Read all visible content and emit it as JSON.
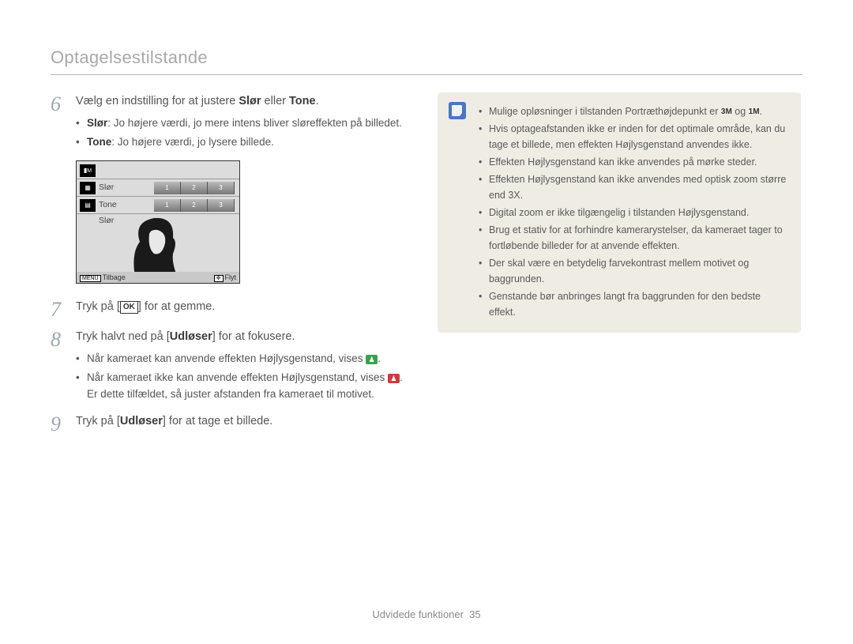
{
  "header": "Optagelsestilstande",
  "steps": {
    "s6": {
      "num": "6",
      "text_a": "Vælg en indstilling for at justere ",
      "bold_a": "Slør",
      "text_b": " eller ",
      "bold_b": "Tone",
      "text_c": ".",
      "bul1_b": "Slør",
      "bul1_t": ": Jo højere værdi, jo mere intens bliver sløreffekten på billedet.",
      "bul2_b": "Tone",
      "bul2_t": ": Jo højere værdi, jo lysere billede."
    },
    "s7": {
      "num": "7",
      "text_a": "Tryk på [",
      "ok": "OK",
      "text_b": "] for at gemme."
    },
    "s8": {
      "num": "8",
      "text_a": "Tryk halvt ned på [",
      "bold": "Udløser",
      "text_b": "] for at fokusere.",
      "bul1": "Når kameraet kan anvende effekten Højlysgenstand, vises ",
      "bul1_end": ".",
      "bul2_a": "Når kameraet ikke kan anvende effekten Højlysgenstand, vises ",
      "bul2_b": ". Er dette tilfældet, så juster afstanden fra kameraet til motivet."
    },
    "s9": {
      "num": "9",
      "text_a": "Tryk på [",
      "bold": "Udløser",
      "text_b": "] for at tage et billede."
    }
  },
  "lcd": {
    "top_icon": "M",
    "row1_label": "Slør",
    "row2_label": "Tone",
    "row3_label": "Slør",
    "footer_menu": "MENU",
    "footer_back": "Tilbage",
    "footer_move": "Flyt",
    "thumb1": "1",
    "thumb2": "2",
    "thumb3": "3"
  },
  "notes": {
    "n1_a": "Mulige opløsninger i tilstanden Portræthøjdepunkt er ",
    "res1": "3M",
    "n1_b": " og ",
    "res2": "1M",
    "n1_c": ".",
    "n2": "Hvis optageafstanden ikke er inden for det optimale område, kan du tage et billede, men effekten Højlysgenstand anvendes ikke.",
    "n3": "Effekten Højlysgenstand kan ikke anvendes på mørke steder.",
    "n4": "Effekten Højlysgenstand kan ikke anvendes med optisk zoom større end 3X.",
    "n5": "Digital zoom er ikke tilgængelig i tilstanden Højlysgenstand.",
    "n6": "Brug et stativ for at forhindre kamerarystelser, da kameraet tager to fortløbende billeder for at anvende effekten.",
    "n7": "Der skal være en betydelig farvekontrast mellem motivet og baggrunden.",
    "n8": "Genstande bør anbringes langt fra baggrunden for den bedste effekt."
  },
  "footer": {
    "section": "Udvidede funktioner",
    "page": "35"
  }
}
